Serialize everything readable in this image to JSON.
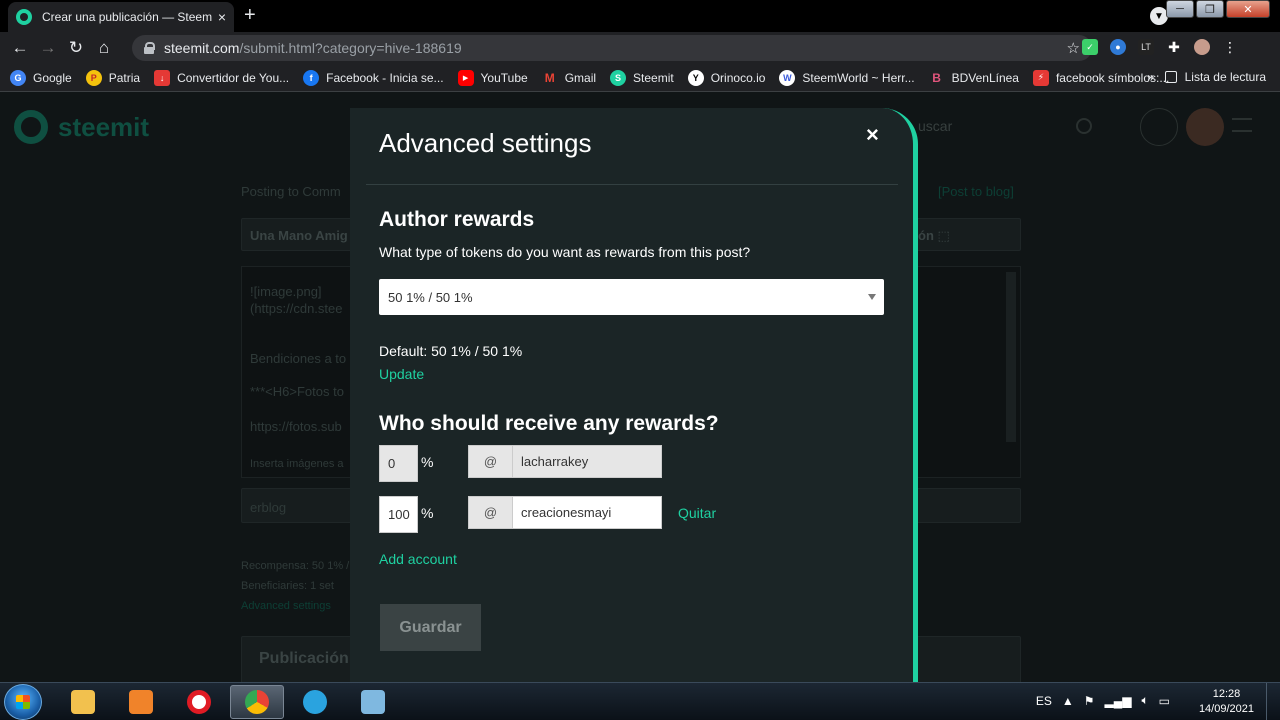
{
  "browser": {
    "tab_title": "Crear una publicación — Steemit",
    "tab_close": "×",
    "new_tab": "+",
    "url_host": "steemit.com",
    "url_path": "/submit.html?category=hive-188619",
    "window_buttons": {
      "minimize": "─",
      "maximize": "❐",
      "close": "✕"
    },
    "bookmarks": [
      {
        "label": "Google",
        "icon": "google-icon",
        "color": "#4285f4",
        "glyph": "G"
      },
      {
        "label": "Patria",
        "icon": "patria-icon",
        "color": "#f4c20d",
        "glyph": "P"
      },
      {
        "label": "Convertidor de You...",
        "icon": "download-icon",
        "color": "#e53935",
        "glyph": "↓"
      },
      {
        "label": "Facebook - Inicia se...",
        "icon": "facebook-icon",
        "color": "#1877f2",
        "glyph": "f"
      },
      {
        "label": "YouTube",
        "icon": "youtube-icon",
        "color": "#ff0000",
        "glyph": "▶"
      },
      {
        "label": "Gmail",
        "icon": "gmail-icon",
        "color": "#d93025",
        "glyph": "M"
      },
      {
        "label": "Steemit",
        "icon": "steemit-icon",
        "color": "#1fd1a1",
        "glyph": "S"
      },
      {
        "label": "Orinoco.io",
        "icon": "orinoco-icon",
        "color": "#ffffff",
        "glyph": "Y"
      },
      {
        "label": "SteemWorld ~ Herr...",
        "icon": "steemworld-icon",
        "color": "#3b5bdb",
        "glyph": "W"
      },
      {
        "label": "BDVenLínea",
        "icon": "bdv-icon",
        "color": "#c2185b",
        "glyph": "B"
      },
      {
        "label": "facebook símbolos:...",
        "icon": "bolt-icon",
        "color": "#e53935",
        "glyph": "⚡"
      }
    ],
    "bookmarks_more": "»",
    "reading_list": "Lista de lectura"
  },
  "background": {
    "logo": "steemit",
    "search_placeholder": "uscar",
    "posting_to": "Posting to Comm",
    "post_to_blog": "[Post to blog]",
    "title_field": "Una Mano Amig",
    "title_field_right": "ón ⬚",
    "body_line_1": "![image.png]",
    "body_line_2": "(https://cdn.stee",
    "body_line_3": "Bendiciones a to",
    "body_line_4": "***<H6>Fotos  to",
    "body_line_5": "https://fotos.sub",
    "body_hint": "Inserta imágenes a",
    "tags_field": "erblog",
    "rewards_info": "Recompensa: 50 1% /",
    "beneficiaries_info": "Beneficiaries: 1 set",
    "advanced_link": "Advanced settings",
    "preview_title": "Publicación"
  },
  "modal": {
    "title": "Advanced settings",
    "close": "×",
    "author_rewards_title": "Author rewards",
    "question": "What type of tokens do you want as rewards from this post?",
    "selected_option": "50 1% / 50 1%",
    "default_text": "Default: 50 1% / 50 1%",
    "update_link": "Update",
    "beneficiaries_title": "Who should receive any rewards?",
    "beneficiaries": [
      {
        "percent": "0",
        "account": "lacharrakey"
      },
      {
        "percent": "100",
        "account": "creacionesmayi"
      }
    ],
    "percent_sign": "%",
    "at_sign": "@",
    "remove_link": "Quitar",
    "add_account_link": "Add account",
    "save_button": "Guardar"
  },
  "taskbar": {
    "language": "ES",
    "time": "12:28",
    "date": "14/09/2021",
    "apps": [
      {
        "name": "file-explorer",
        "color": "#f2c14e"
      },
      {
        "name": "media-player",
        "color": "#f0832a"
      },
      {
        "name": "opera",
        "color": "#e01b24"
      },
      {
        "name": "chrome",
        "color": "#34a853"
      },
      {
        "name": "telegram",
        "color": "#2aa3df"
      },
      {
        "name": "notepad",
        "color": "#7fb8e0"
      }
    ]
  },
  "colors": {
    "accent": "#1fd1a1",
    "modal_bg": "#1b2526"
  }
}
